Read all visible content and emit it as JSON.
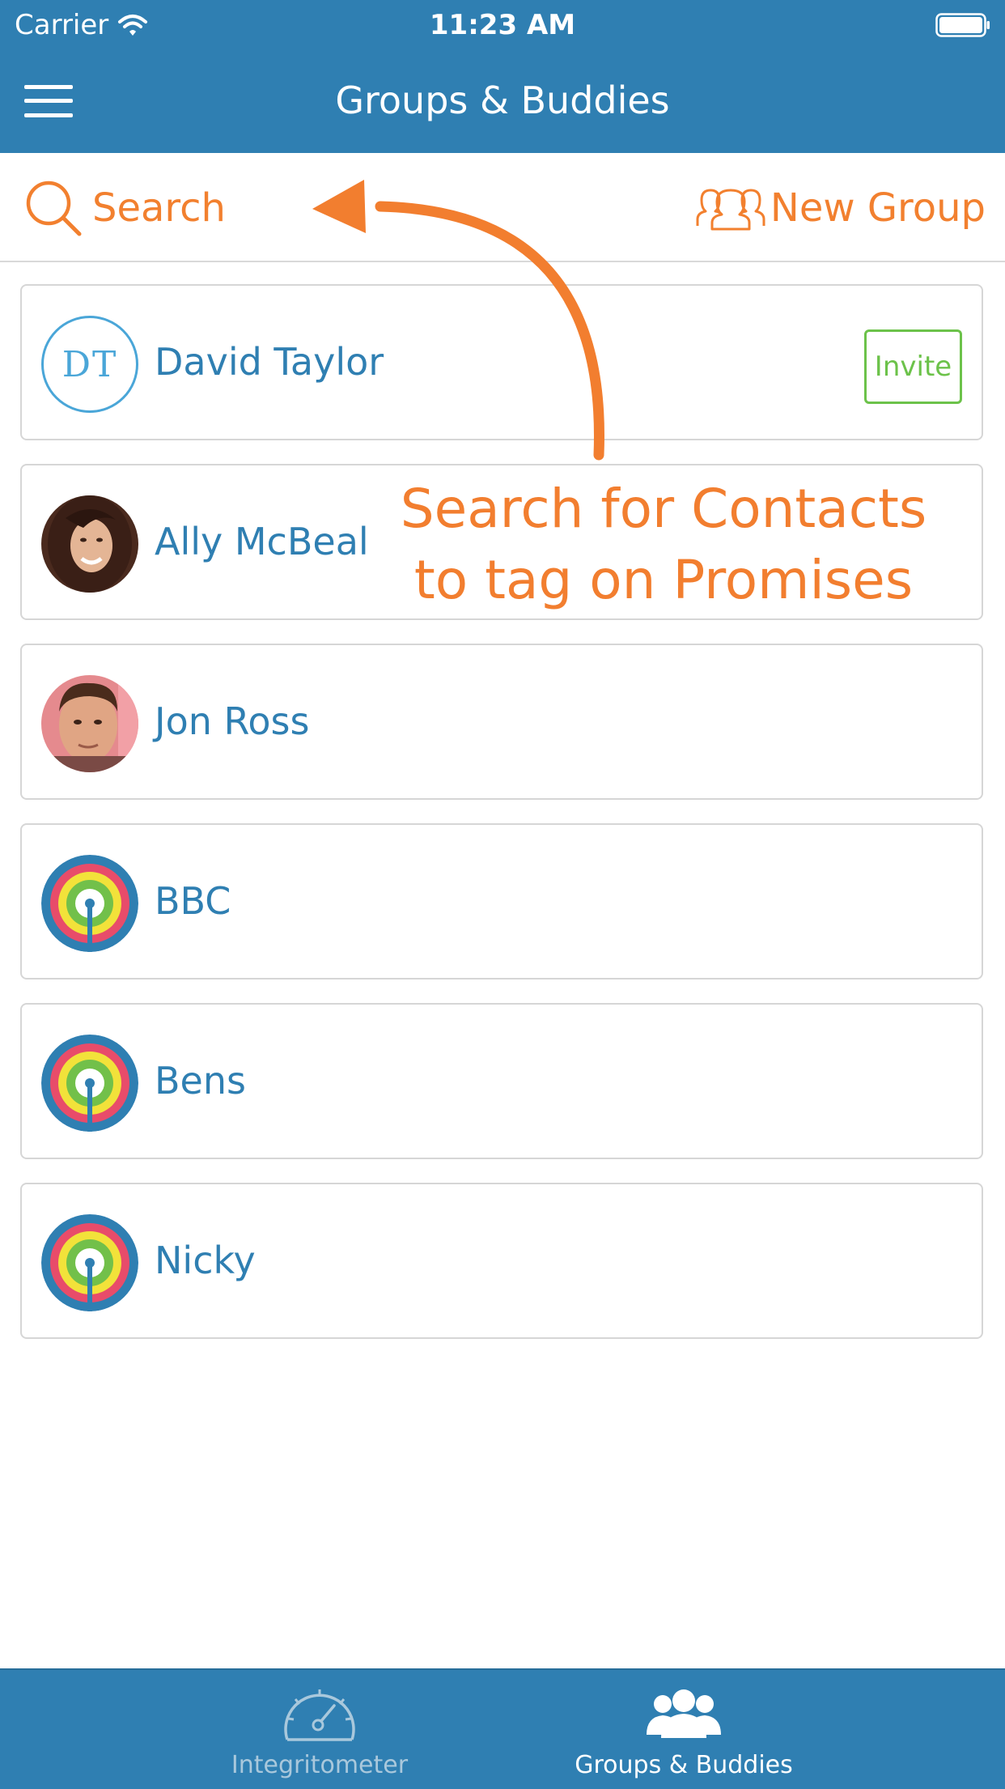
{
  "status_bar": {
    "carrier": "Carrier",
    "time": "11:23 AM"
  },
  "nav": {
    "title": "Groups & Buddies",
    "menu_icon": "hamburger-menu-icon"
  },
  "toolbar": {
    "search_label": "Search",
    "new_group_label": "New Group"
  },
  "contacts": [
    {
      "name": "David Taylor",
      "avatar_type": "initials",
      "initials": "DT",
      "action": "Invite"
    },
    {
      "name": "Ally McBeal",
      "avatar_type": "photo"
    },
    {
      "name": "Jon Ross",
      "avatar_type": "photo"
    },
    {
      "name": "BBC",
      "avatar_type": "group-logo"
    },
    {
      "name": "Bens",
      "avatar_type": "group-logo"
    },
    {
      "name": "Nicky",
      "avatar_type": "group-logo"
    }
  ],
  "annotation": {
    "line1": "Search for Contacts",
    "line2": "to tag on Promises"
  },
  "tabs": [
    {
      "label": "Integritometer",
      "icon": "speedometer-icon",
      "selected": false
    },
    {
      "label": "Groups & Buddies",
      "icon": "group-icon",
      "selected": true
    }
  ],
  "colors": {
    "primary": "#2f7fb2",
    "accent": "#f2802f",
    "invite": "#6cc24a"
  }
}
